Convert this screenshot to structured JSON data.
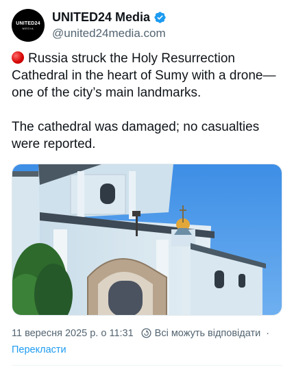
{
  "author": {
    "avatar_line1": "UNITED24",
    "avatar_line2": "MEDIA",
    "display_name": "UNITED24 Media",
    "handle": "@united24media.com",
    "verified": true,
    "verified_icon": "verified-badge-icon",
    "verified_color": "#1d9bf0"
  },
  "post": {
    "emoji_icon": "red-circle-icon",
    "paragraph1": "Russia struck the Holy Resurrection Cathedral in the heart of Sumy with a drone—one of the city’s main landmarks.",
    "paragraph2": "The cathedral was damaged; no casualties were reported.",
    "media_icon": "cathedral-photo"
  },
  "footer": {
    "timestamp": "11 вересня 2025 р. о 11:31",
    "reply_icon": "reply-settings-icon",
    "reply_setting": "Всі можуть відповідати",
    "separator": "·",
    "translate_label": "Перекласти",
    "link_color": "#1d9bf0"
  }
}
